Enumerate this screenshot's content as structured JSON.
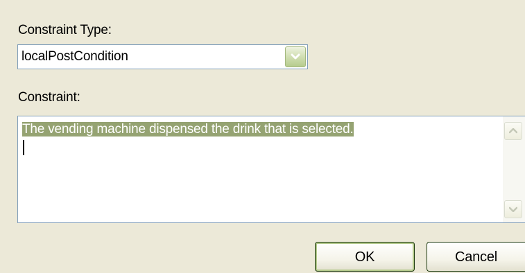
{
  "constraint_type": {
    "label": "Constraint Type:",
    "selected": "localPostCondition"
  },
  "constraint": {
    "label": "Constraint:",
    "value": "The vending machine dispensed the drink that is selected."
  },
  "buttons": {
    "ok": "OK",
    "cancel": "Cancel"
  },
  "colors": {
    "dialog_bg": "#ece9d8",
    "selection_bg": "#95a372",
    "field_border": "#7f9db9"
  },
  "icons": {
    "dropdown": "chevron-down-icon",
    "scroll_up": "scroll-up-arrow-icon",
    "scroll_down": "scroll-down-arrow-icon"
  }
}
